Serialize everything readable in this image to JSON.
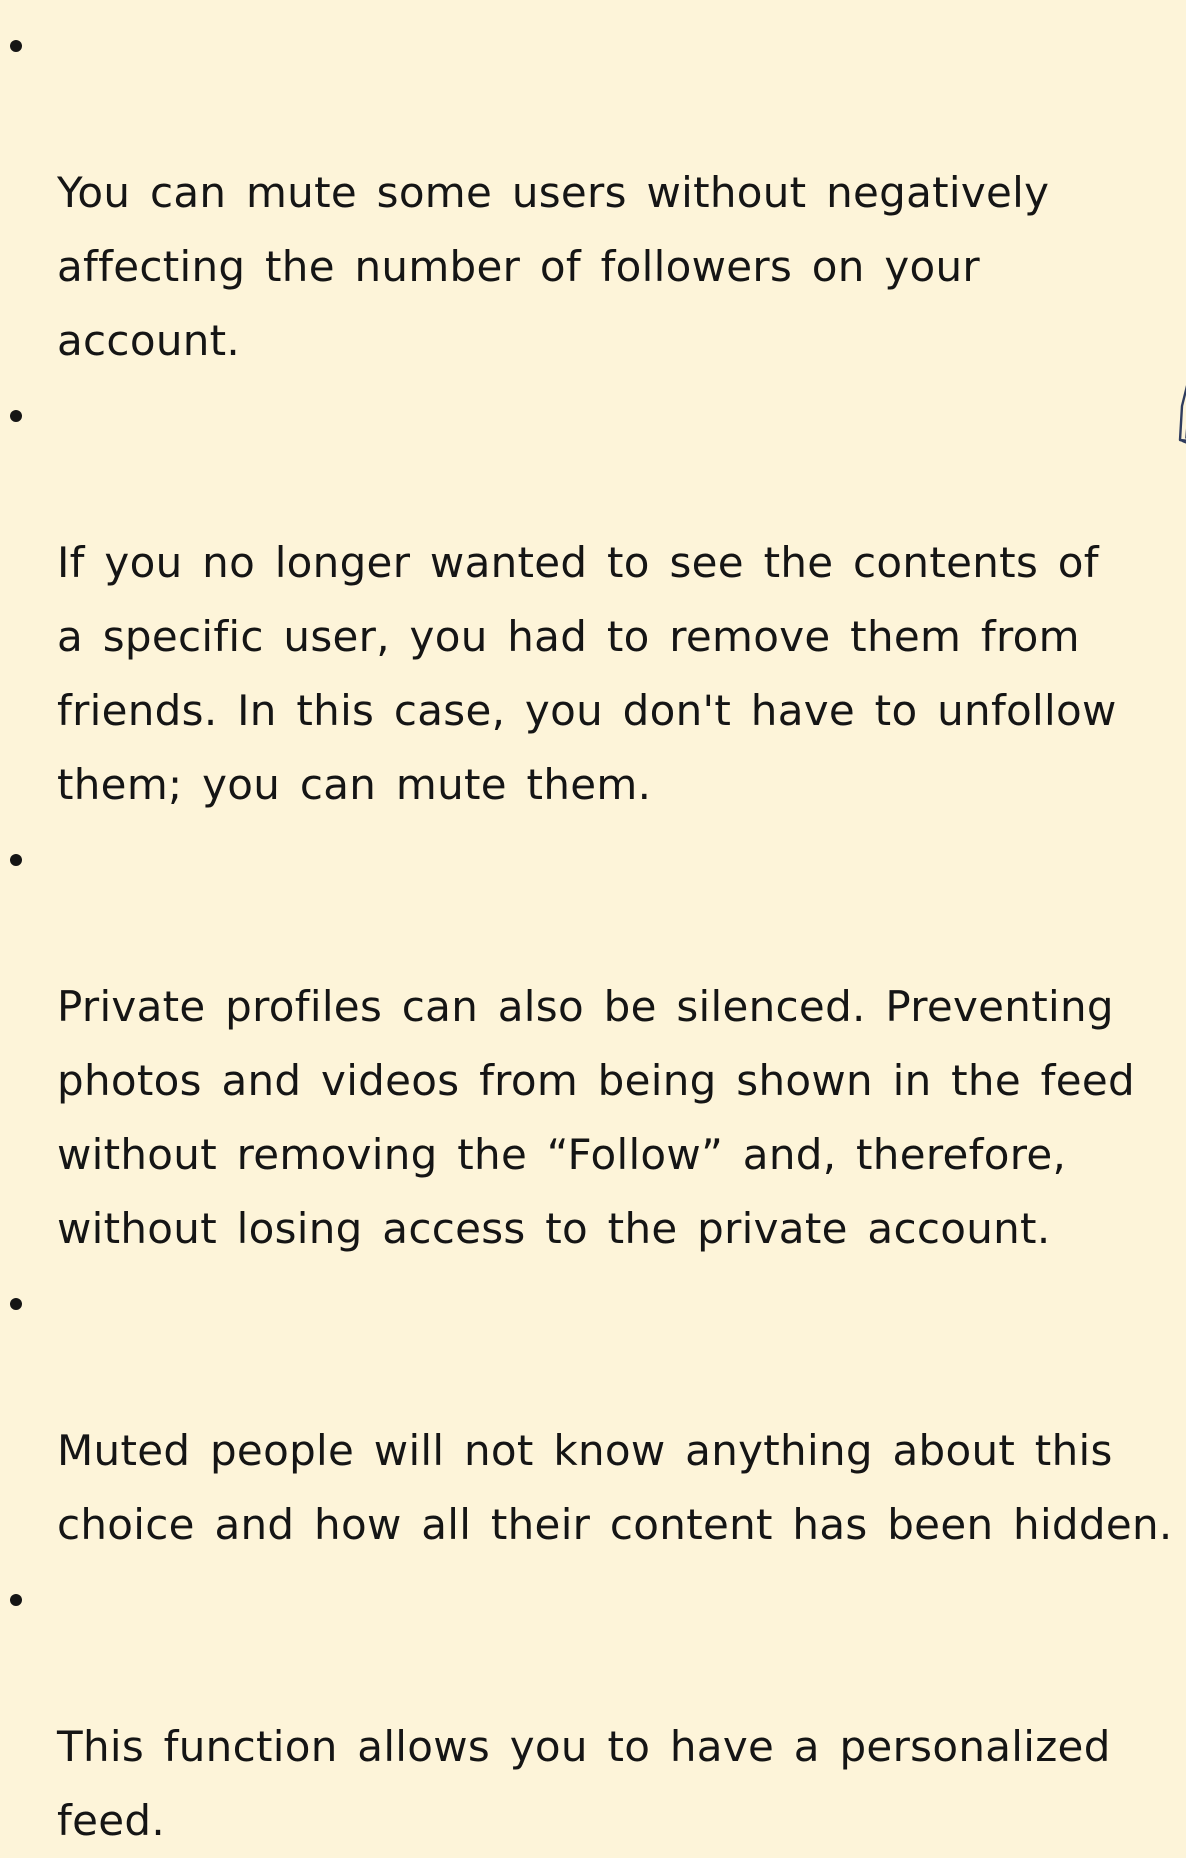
{
  "bullets": [
    {
      "text": "You can mute some users without negatively\naffecting the number of followers on your\naccount."
    },
    {
      "text": "If you no longer wanted to see the contents of\na specific user, you had to remove them from\nfriends. In this case, you don't have to unfollow\nthem; you can mute them."
    },
    {
      "text": "Private profiles can also be silenced. Preventing\nphotos and videos from being shown in the feed\nwithout removing the “Follow” and, therefore,\nwithout losing access to the private account."
    },
    {
      "text": "Muted people will not know anything about this\nchoice and how all their content has been hidden."
    },
    {
      "text": "This function allows you to have a personalized\nfeed."
    }
  ],
  "colors": {
    "background": "#fdf4d9",
    "text": "#151515",
    "decoration": "#2f3c5e"
  }
}
